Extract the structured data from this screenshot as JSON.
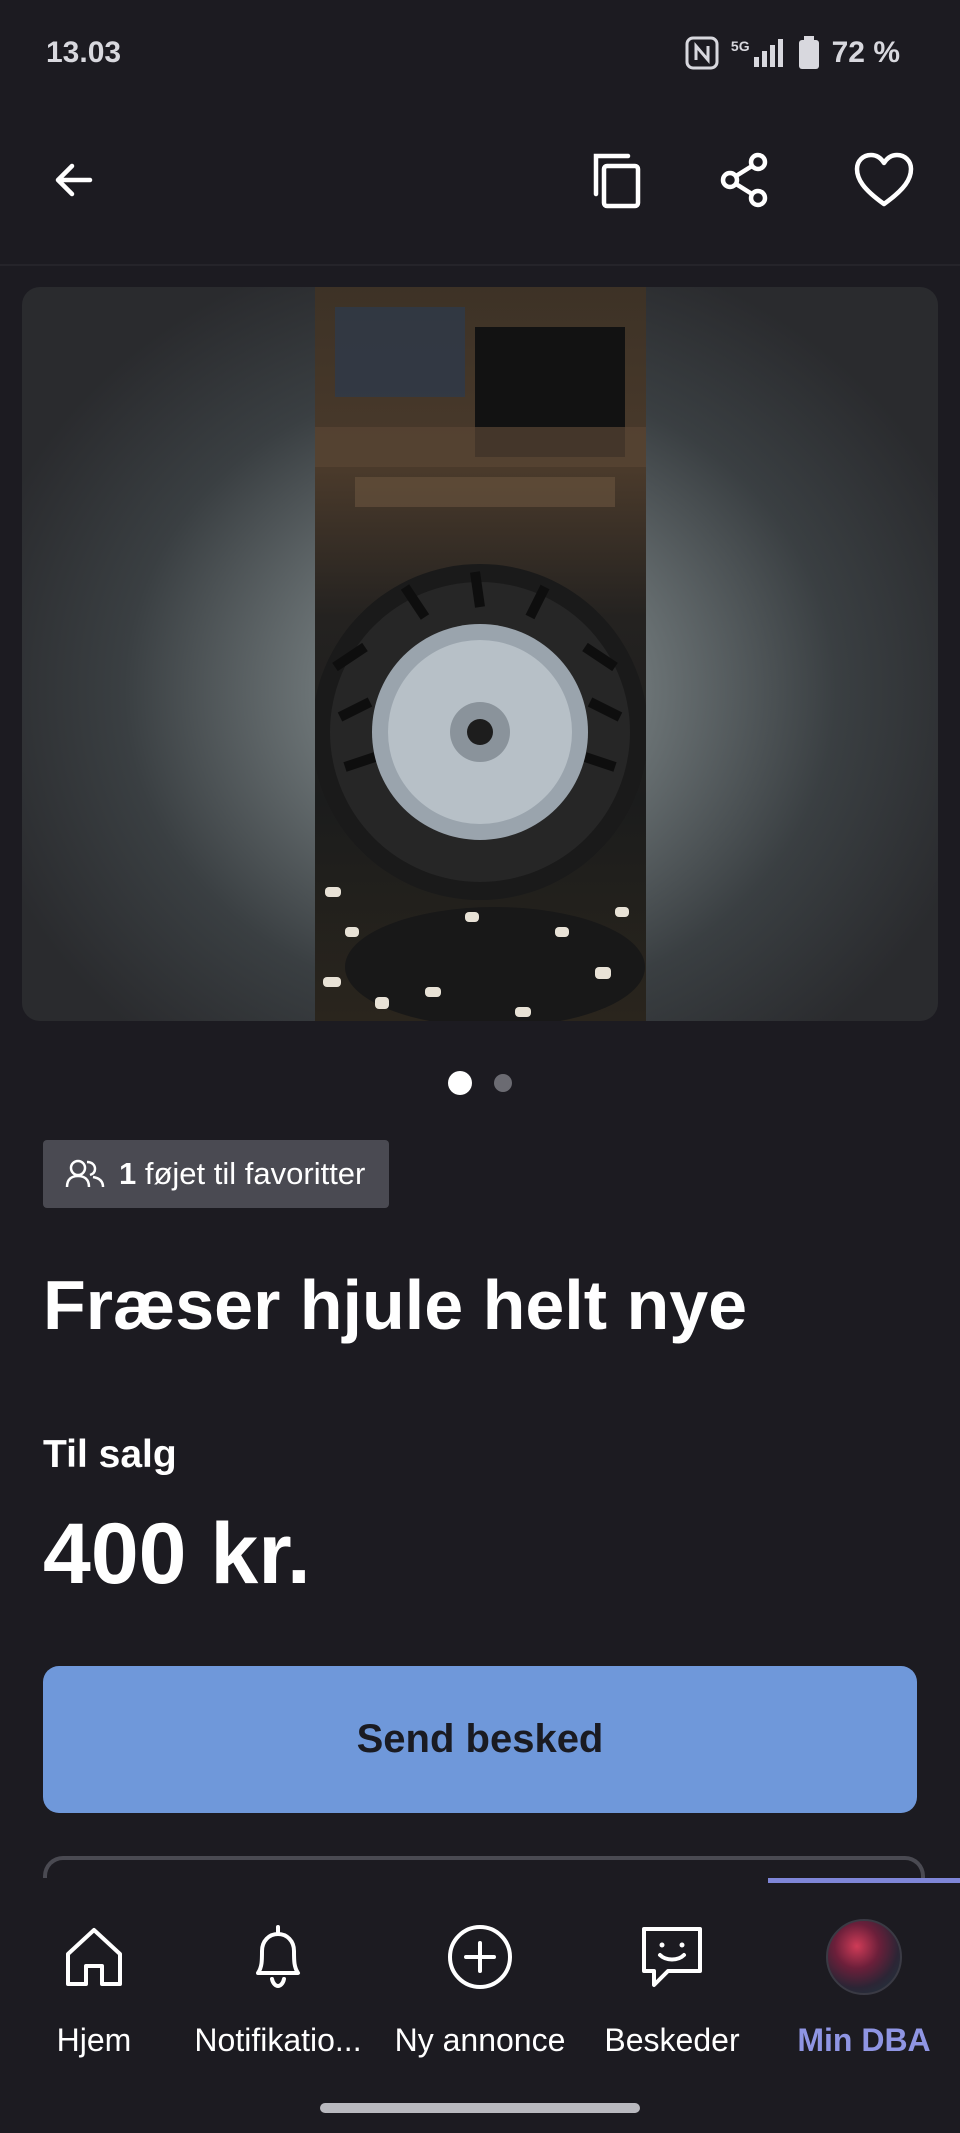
{
  "status_bar": {
    "time": "13.03",
    "network": "5G",
    "battery": "72 %"
  },
  "listing": {
    "favorites_count": "1",
    "favorites_text": "føjet til favoritter",
    "title": "Fræser hjule helt nye",
    "sale_type": "Til salg",
    "price": "400 kr.",
    "send_button": "Send besked",
    "gallery": {
      "total_images": 2,
      "current_index": 1
    }
  },
  "bottom_nav": {
    "items": [
      {
        "label": "Hjem",
        "icon": "home-icon"
      },
      {
        "label": "Notifikatio...",
        "icon": "bell-icon"
      },
      {
        "label": "Ny annonce",
        "icon": "plus-circle-icon"
      },
      {
        "label": "Beskeder",
        "icon": "chat-smile-icon"
      },
      {
        "label": "Min DBA",
        "icon": "avatar"
      }
    ],
    "active": "Min DBA",
    "active_color": "#8f95e3"
  },
  "colors": {
    "background": "#1c1b21",
    "primary_button": "#6f98da",
    "badge": "#4a4a52"
  }
}
